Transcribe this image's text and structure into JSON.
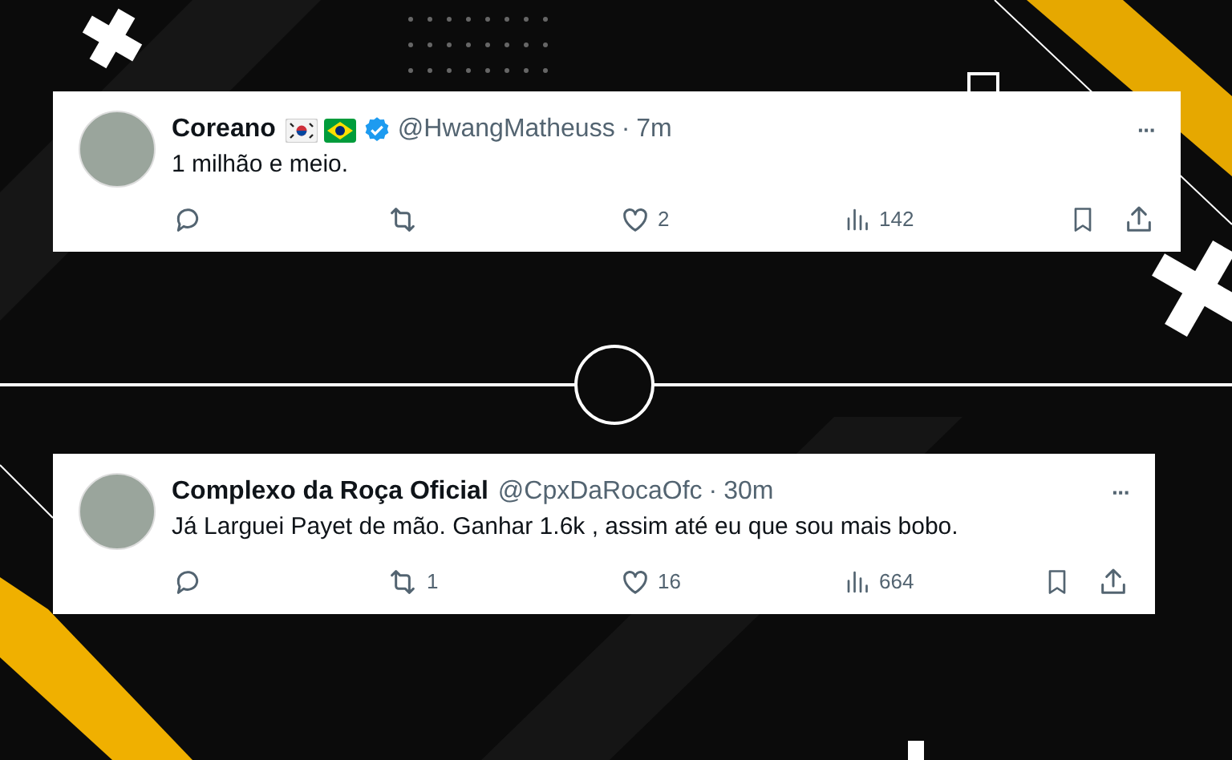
{
  "tweets": [
    {
      "name": "Coreano",
      "country_flags": true,
      "verified": true,
      "handle": "@HwangMatheuss",
      "separator": "·",
      "time": "7m",
      "text": "1 milhão e meio.",
      "likes": "2",
      "views": "142",
      "more": "···"
    },
    {
      "name": "Complexo da Roça Oficial",
      "country_flags": false,
      "verified": false,
      "handle": "@CpxDaRocaOfc",
      "separator": "·",
      "time": "30m",
      "text": "Já Larguei Payet de mão. Ganhar 1.6k , assim até eu que sou mais bobo.",
      "retweets": "1",
      "likes": "16",
      "views": "664",
      "more": "···"
    }
  ]
}
